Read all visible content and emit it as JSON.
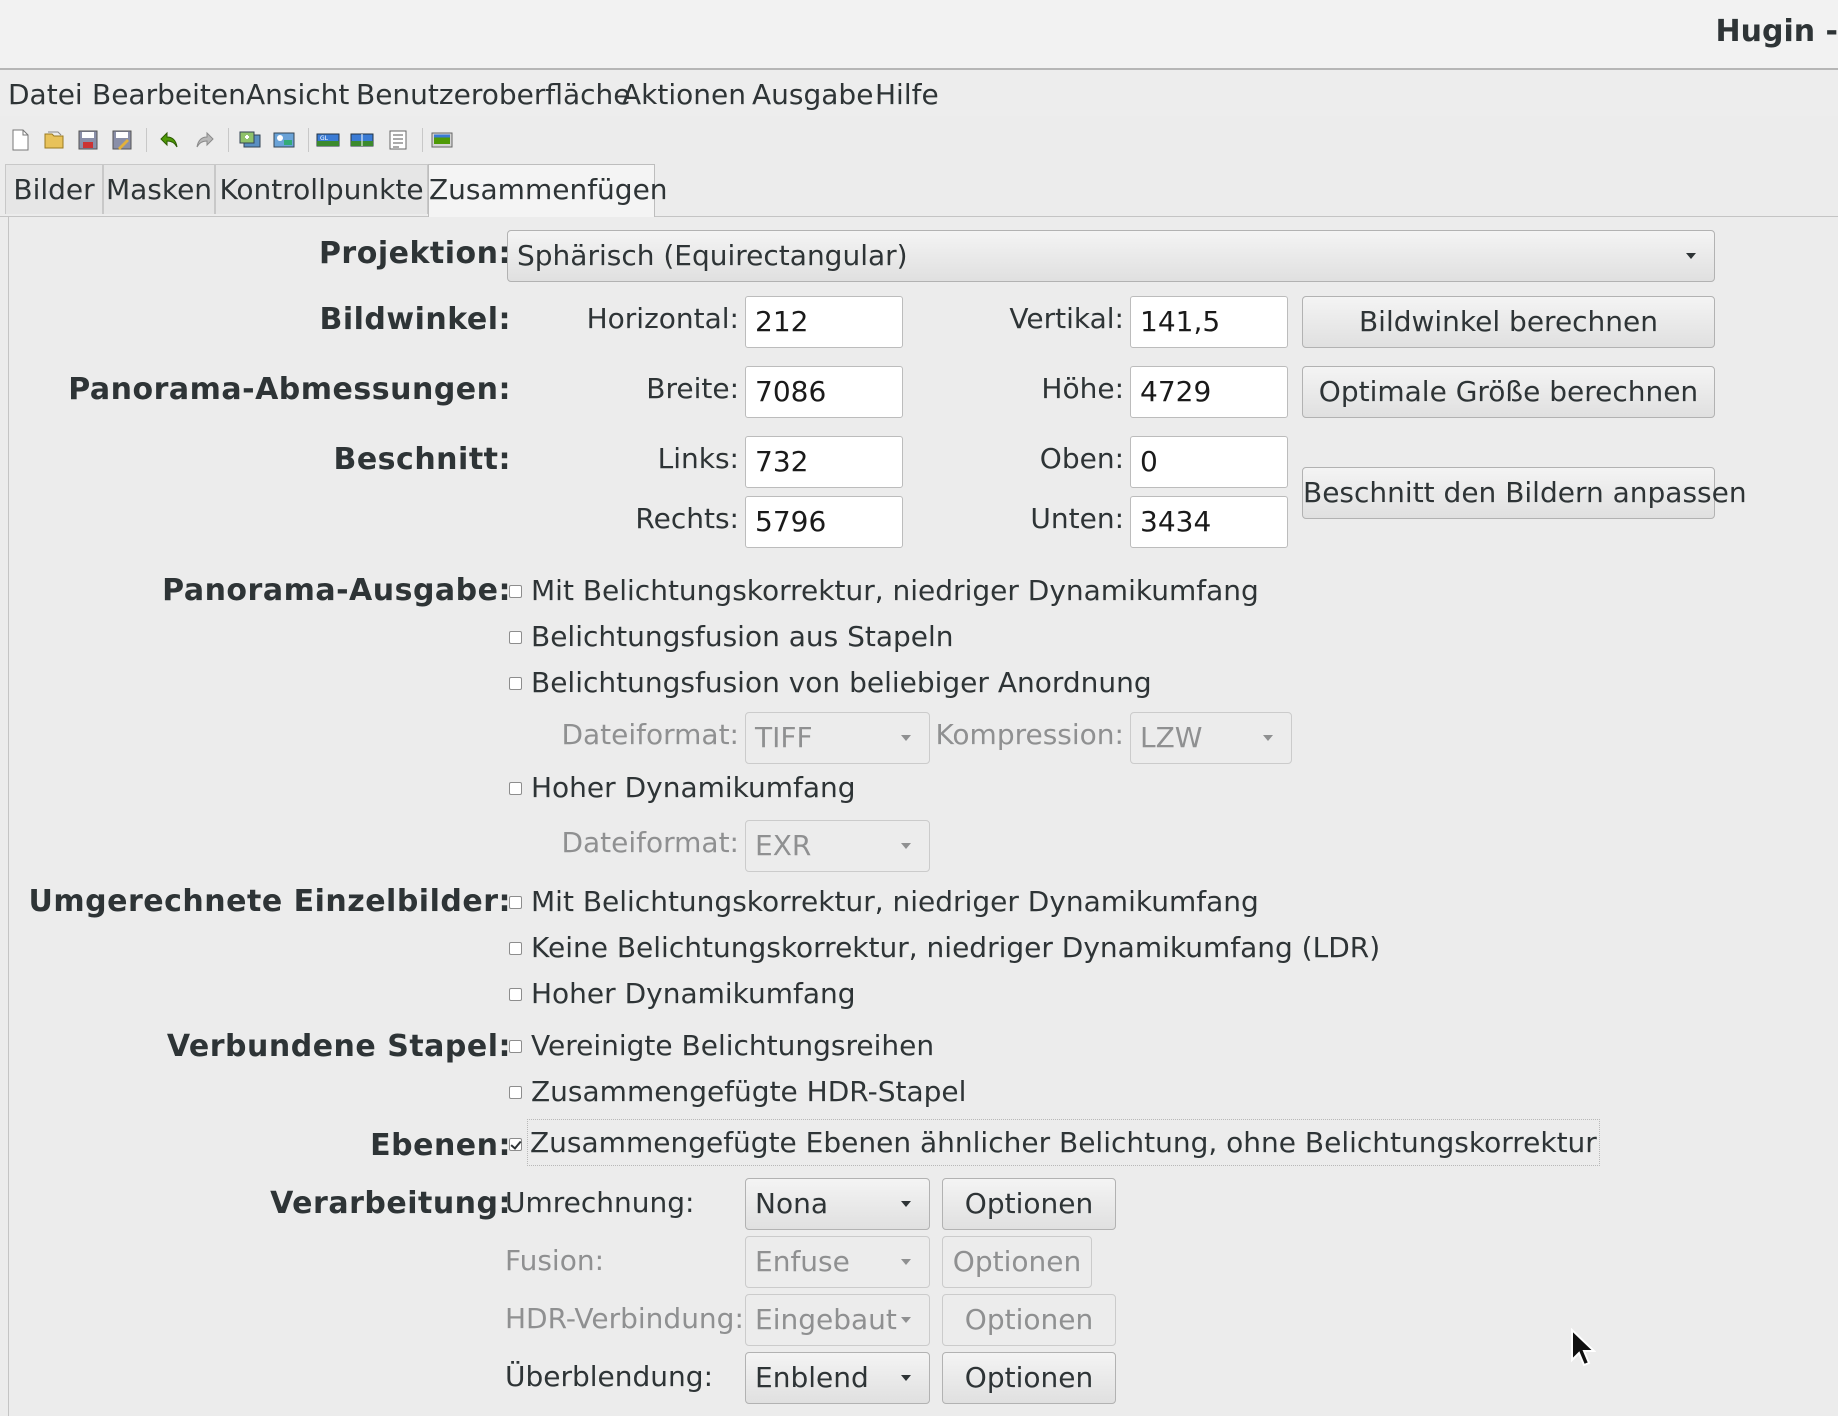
{
  "window": {
    "title": "Hugin -"
  },
  "menu": [
    "Datei",
    "Bearbeiten",
    "Ansicht",
    "Benutzeroberfläche",
    "Aktionen",
    "Ausgabe",
    "Hilfe"
  ],
  "tabs": [
    "Bilder",
    "Masken",
    "Kontrollpunkte",
    "Zusammenfügen"
  ],
  "active_tab": "Zusammenfügen",
  "projection": {
    "label": "Projektion:",
    "value": "Sphärisch (Equirectangular)"
  },
  "fov": {
    "label": "Bildwinkel:",
    "h_label": "Horizontal:",
    "h_value": "212",
    "v_label": "Vertikal:",
    "v_value": "141,5",
    "calc_button": "Bildwinkel berechnen"
  },
  "size": {
    "label": "Panorama-Abmessungen:",
    "w_label": "Breite:",
    "w_value": "7086",
    "h_label": "Höhe:",
    "h_value": "4729",
    "calc_button": "Optimale Größe berechnen"
  },
  "crop": {
    "label": "Beschnitt:",
    "left_label": "Links:",
    "left_value": "732",
    "top_label": "Oben:",
    "top_value": "0",
    "right_label": "Rechts:",
    "right_value": "5796",
    "bottom_label": "Unten:",
    "bottom_value": "3434",
    "fit_button": "Beschnitt den Bildern anpassen"
  },
  "output": {
    "label": "Panorama-Ausgabe:",
    "opt1": "Mit Belichtungskorrektur, niedriger Dynamikumfang",
    "opt2": "Belichtungsfusion aus Stapeln",
    "opt3": "Belichtungsfusion von beliebiger Anordnung",
    "format_label": "Dateiformat:",
    "format_value": "TIFF",
    "compression_label": "Kompression:",
    "compression_value": "LZW",
    "opt4": "Hoher Dynamikumfang",
    "hdr_format_label": "Dateiformat:",
    "hdr_format_value": "EXR"
  },
  "remapped": {
    "label": "Umgerechnete Einzelbilder:",
    "opt1": "Mit Belichtungskorrektur, niedriger Dynamikumfang",
    "opt2": "Keine Belichtungskorrektur, niedriger Dynamikumfang (LDR)",
    "opt3": "Hoher Dynamikumfang"
  },
  "stacks": {
    "label": "Verbundene Stapel:",
    "opt1": "Vereinigte Belichtungsreihen",
    "opt2": "Zusammengefügte HDR-Stapel"
  },
  "layers": {
    "label": "Ebenen:",
    "opt1": "Zusammengefügte Ebenen ähnlicher Belichtung, ohne Belichtungskorrektur",
    "opt1_checked": true
  },
  "processing": {
    "label": "Verarbeitung:",
    "remap_label": "Umrechnung:",
    "remap_value": "Nona",
    "remap_button": "Optionen",
    "fusion_label": "Fusion:",
    "fusion_value": "Enfuse",
    "fusion_button": "Optionen",
    "hdr_label": "HDR-Verbindung:",
    "hdr_value": "Eingebaut",
    "hdr_button": "Optionen",
    "blend_label": "Überblendung:",
    "blend_value": "Enblend",
    "blend_button": "Optionen"
  }
}
